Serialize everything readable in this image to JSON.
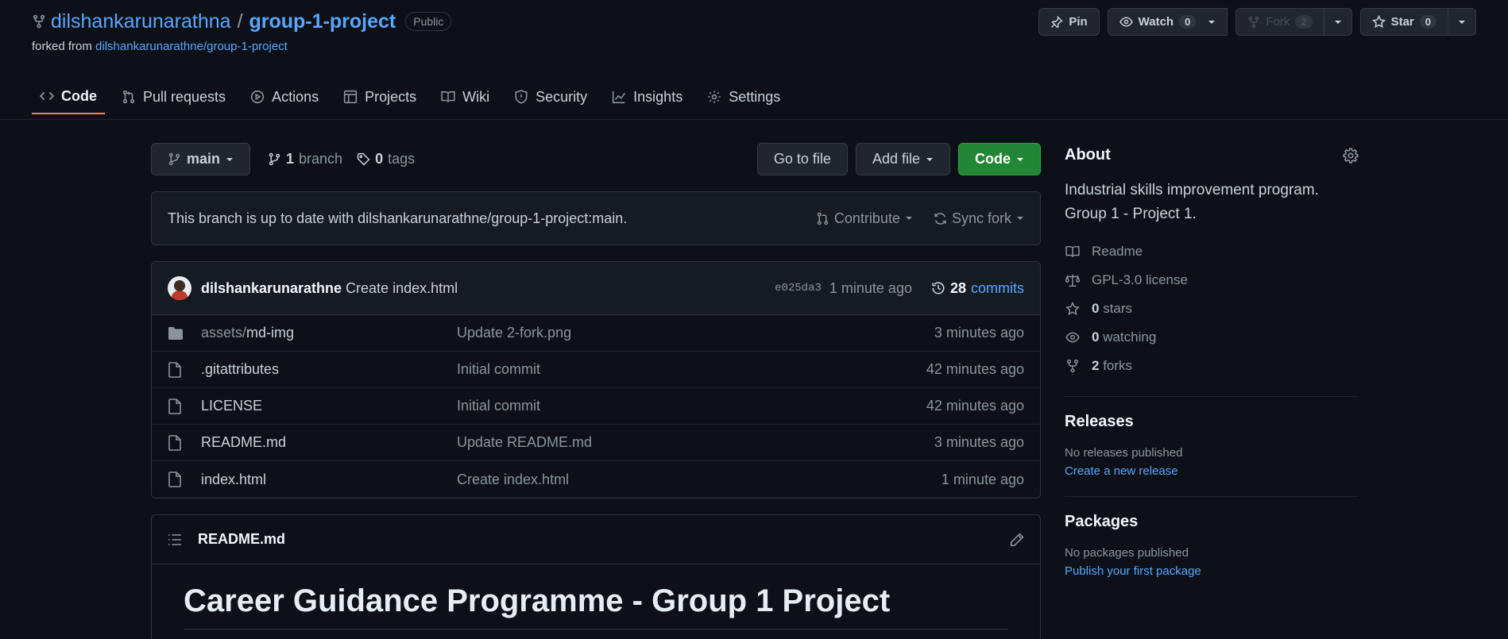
{
  "repo": {
    "owner": "dilshankarunarathna",
    "separator": "/",
    "name": "group-1-project",
    "visibility": "Public",
    "forked_prefix": "forked from",
    "forked_from": "dilshankarunarathne/group-1-project"
  },
  "actions": {
    "pin": "Pin",
    "watch": "Watch",
    "watch_count": "0",
    "fork": "Fork",
    "fork_count": "2",
    "star": "Star",
    "star_count": "0"
  },
  "tabs": [
    {
      "label": "Code",
      "icon": "code-icon"
    },
    {
      "label": "Pull requests",
      "icon": "pull-request-icon"
    },
    {
      "label": "Actions",
      "icon": "play-icon"
    },
    {
      "label": "Projects",
      "icon": "table-icon"
    },
    {
      "label": "Wiki",
      "icon": "book-icon"
    },
    {
      "label": "Security",
      "icon": "shield-icon"
    },
    {
      "label": "Insights",
      "icon": "graph-icon"
    },
    {
      "label": "Settings",
      "icon": "gear-icon"
    }
  ],
  "toolbar": {
    "branch": "main",
    "branch_count": "1",
    "branch_word": "branch",
    "tag_count": "0",
    "tag_word": "tags",
    "go_to_file": "Go to file",
    "add_file": "Add file",
    "code": "Code"
  },
  "status": {
    "message": "This branch is up to date with dilshankarunarathne/group-1-project:main.",
    "contribute": "Contribute",
    "sync": "Sync fork"
  },
  "commit": {
    "author": "dilshankarunarathne",
    "message": "Create index.html",
    "sha": "e025da3",
    "time": "1 minute ago",
    "count": "28",
    "count_word": "commits"
  },
  "files": [
    {
      "type": "folder",
      "prefix": "assets/",
      "name": "md-img",
      "message": "Update 2-fork.png",
      "time": "3 minutes ago"
    },
    {
      "type": "file",
      "prefix": "",
      "name": ".gitattributes",
      "message": "Initial commit",
      "time": "42 minutes ago"
    },
    {
      "type": "file",
      "prefix": "",
      "name": "LICENSE",
      "message": "Initial commit",
      "time": "42 minutes ago"
    },
    {
      "type": "file",
      "prefix": "",
      "name": "README.md",
      "message": "Update README.md",
      "time": "3 minutes ago"
    },
    {
      "type": "file",
      "prefix": "",
      "name": "index.html",
      "message": "Create index.html",
      "time": "1 minute ago"
    }
  ],
  "readme": {
    "filename": "README.md",
    "heading": "Career Guidance Programme - Group 1 Project"
  },
  "about": {
    "title": "About",
    "description": "Industrial skills improvement program. Group 1 - Project 1.",
    "readme": "Readme",
    "license": "GPL-3.0 license",
    "stars_count": "0",
    "stars_word": "stars",
    "watching_count": "0",
    "watching_word": "watching",
    "forks_count": "2",
    "forks_word": "forks"
  },
  "releases": {
    "title": "Releases",
    "none": "No releases published",
    "create": "Create a new release"
  },
  "packages": {
    "title": "Packages",
    "none": "No packages published",
    "publish": "Publish your first package"
  }
}
